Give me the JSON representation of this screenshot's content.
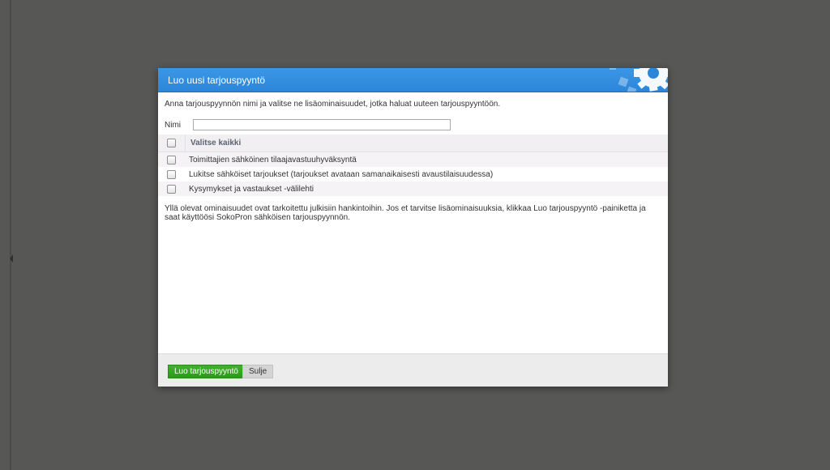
{
  "colors": {
    "backdrop": "#575755",
    "header": "#2b86da",
    "primary_button": "#2b9a1a",
    "secondary_button": "#d4d4d4"
  },
  "dialog": {
    "title": "Luo uusi tarjouspyyntö",
    "header_decoration_icon": "gear-icon",
    "intro": "Anna tarjouspyynnön nimi ja valitse ne lisäominaisuudet, jotka haluat uuteen tarjouspyyntöön.",
    "name_label": "Nimi",
    "name_value": "",
    "select_all_label": "Valitse kaikki",
    "options": [
      {
        "label": "Toimittajien sähköinen tilaajavastuuhyväksyntä",
        "checked": false
      },
      {
        "label": "Lukitse sähköiset tarjoukset (tarjoukset avataan samanaikaisesti avaustilaisuudessa)",
        "checked": false
      },
      {
        "label": "Kysymykset ja vastaukset -välilehti",
        "checked": false
      }
    ],
    "note": "Yllä olevat ominaisuudet ovat tarkoitettu julkisiin hankintoihin. Jos et tarvitse lisäominaisuuksia, klikkaa Luo tarjouspyyntö -painiketta ja saat käyttöösi SokoPron sähköisen tarjouspyynnön.",
    "create_button": "Luo tarjouspyyntö",
    "close_button": "Sulje"
  }
}
